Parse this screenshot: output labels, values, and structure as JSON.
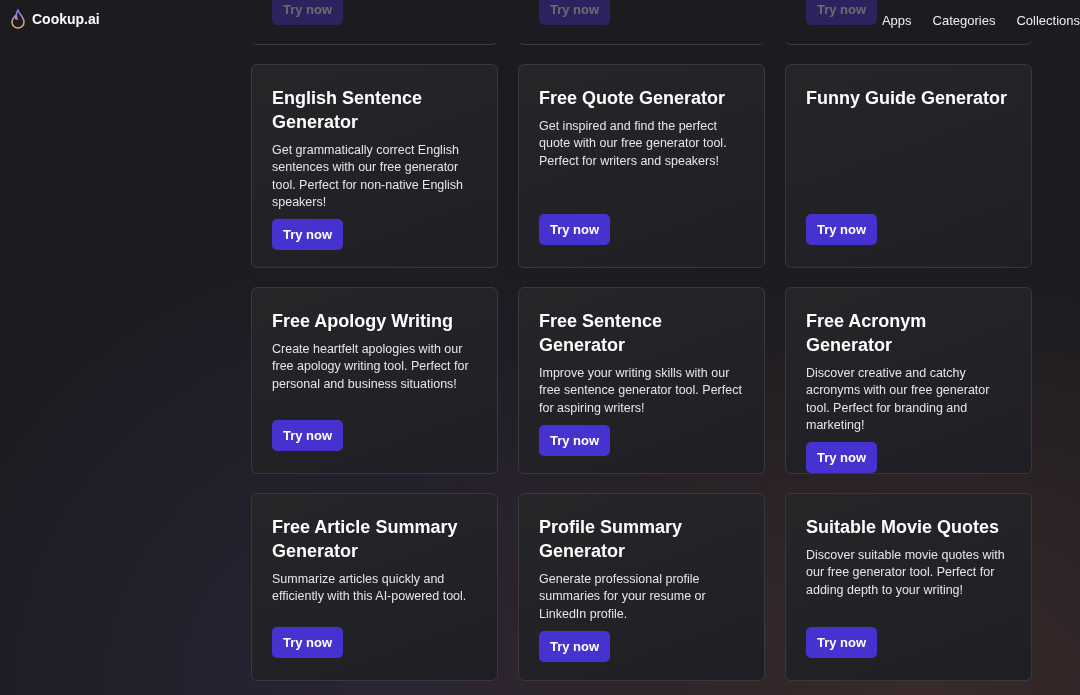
{
  "header": {
    "logo": "Cookup.ai",
    "nav": [
      "Apps",
      "Categories",
      "Collections"
    ]
  },
  "cut_off_row": {
    "buttons": [
      "Try now",
      "Try now",
      "Try now"
    ]
  },
  "cards": [
    {
      "title": "English Sentence Generator",
      "description": "Get grammatically correct English sentences with our free generator tool. Perfect for non-native English speakers!",
      "button": "Try now"
    },
    {
      "title": "Free Quote Generator",
      "description": "Get inspired and find the perfect quote with our free generator tool. Perfect for writers and speakers!",
      "button": "Try now"
    },
    {
      "title": "Funny Guide Generator",
      "button": "Try now"
    },
    {
      "title": "Free Apology Writing",
      "description": "Create heartfelt apologies with our free apology writing tool. Perfect for personal and business situations!",
      "button": "Try now"
    },
    {
      "title": "Free Sentence Generator",
      "description": "Improve your writing skills with our free sentence generator tool. Perfect for aspiring writers!",
      "button": "Try now"
    },
    {
      "title": "Free Acronym Generator",
      "description": "Discover creative and catchy acronyms with our free generator tool. Perfect for branding and marketing!",
      "button": "Try now"
    },
    {
      "title": "Free Article Summary Generator",
      "description": "Summarize articles quickly and efficiently with this AI-powered tool.",
      "button": "Try now"
    },
    {
      "title": "Profile Summary Generator",
      "description": "Generate professional profile summaries for your resume or LinkedIn profile.",
      "button": "Try now"
    },
    {
      "title": "Suitable Movie Quotes",
      "description": "Discover suitable movie quotes with our free generator tool. Perfect for adding depth to your writing!",
      "button": "Try now"
    }
  ]
}
